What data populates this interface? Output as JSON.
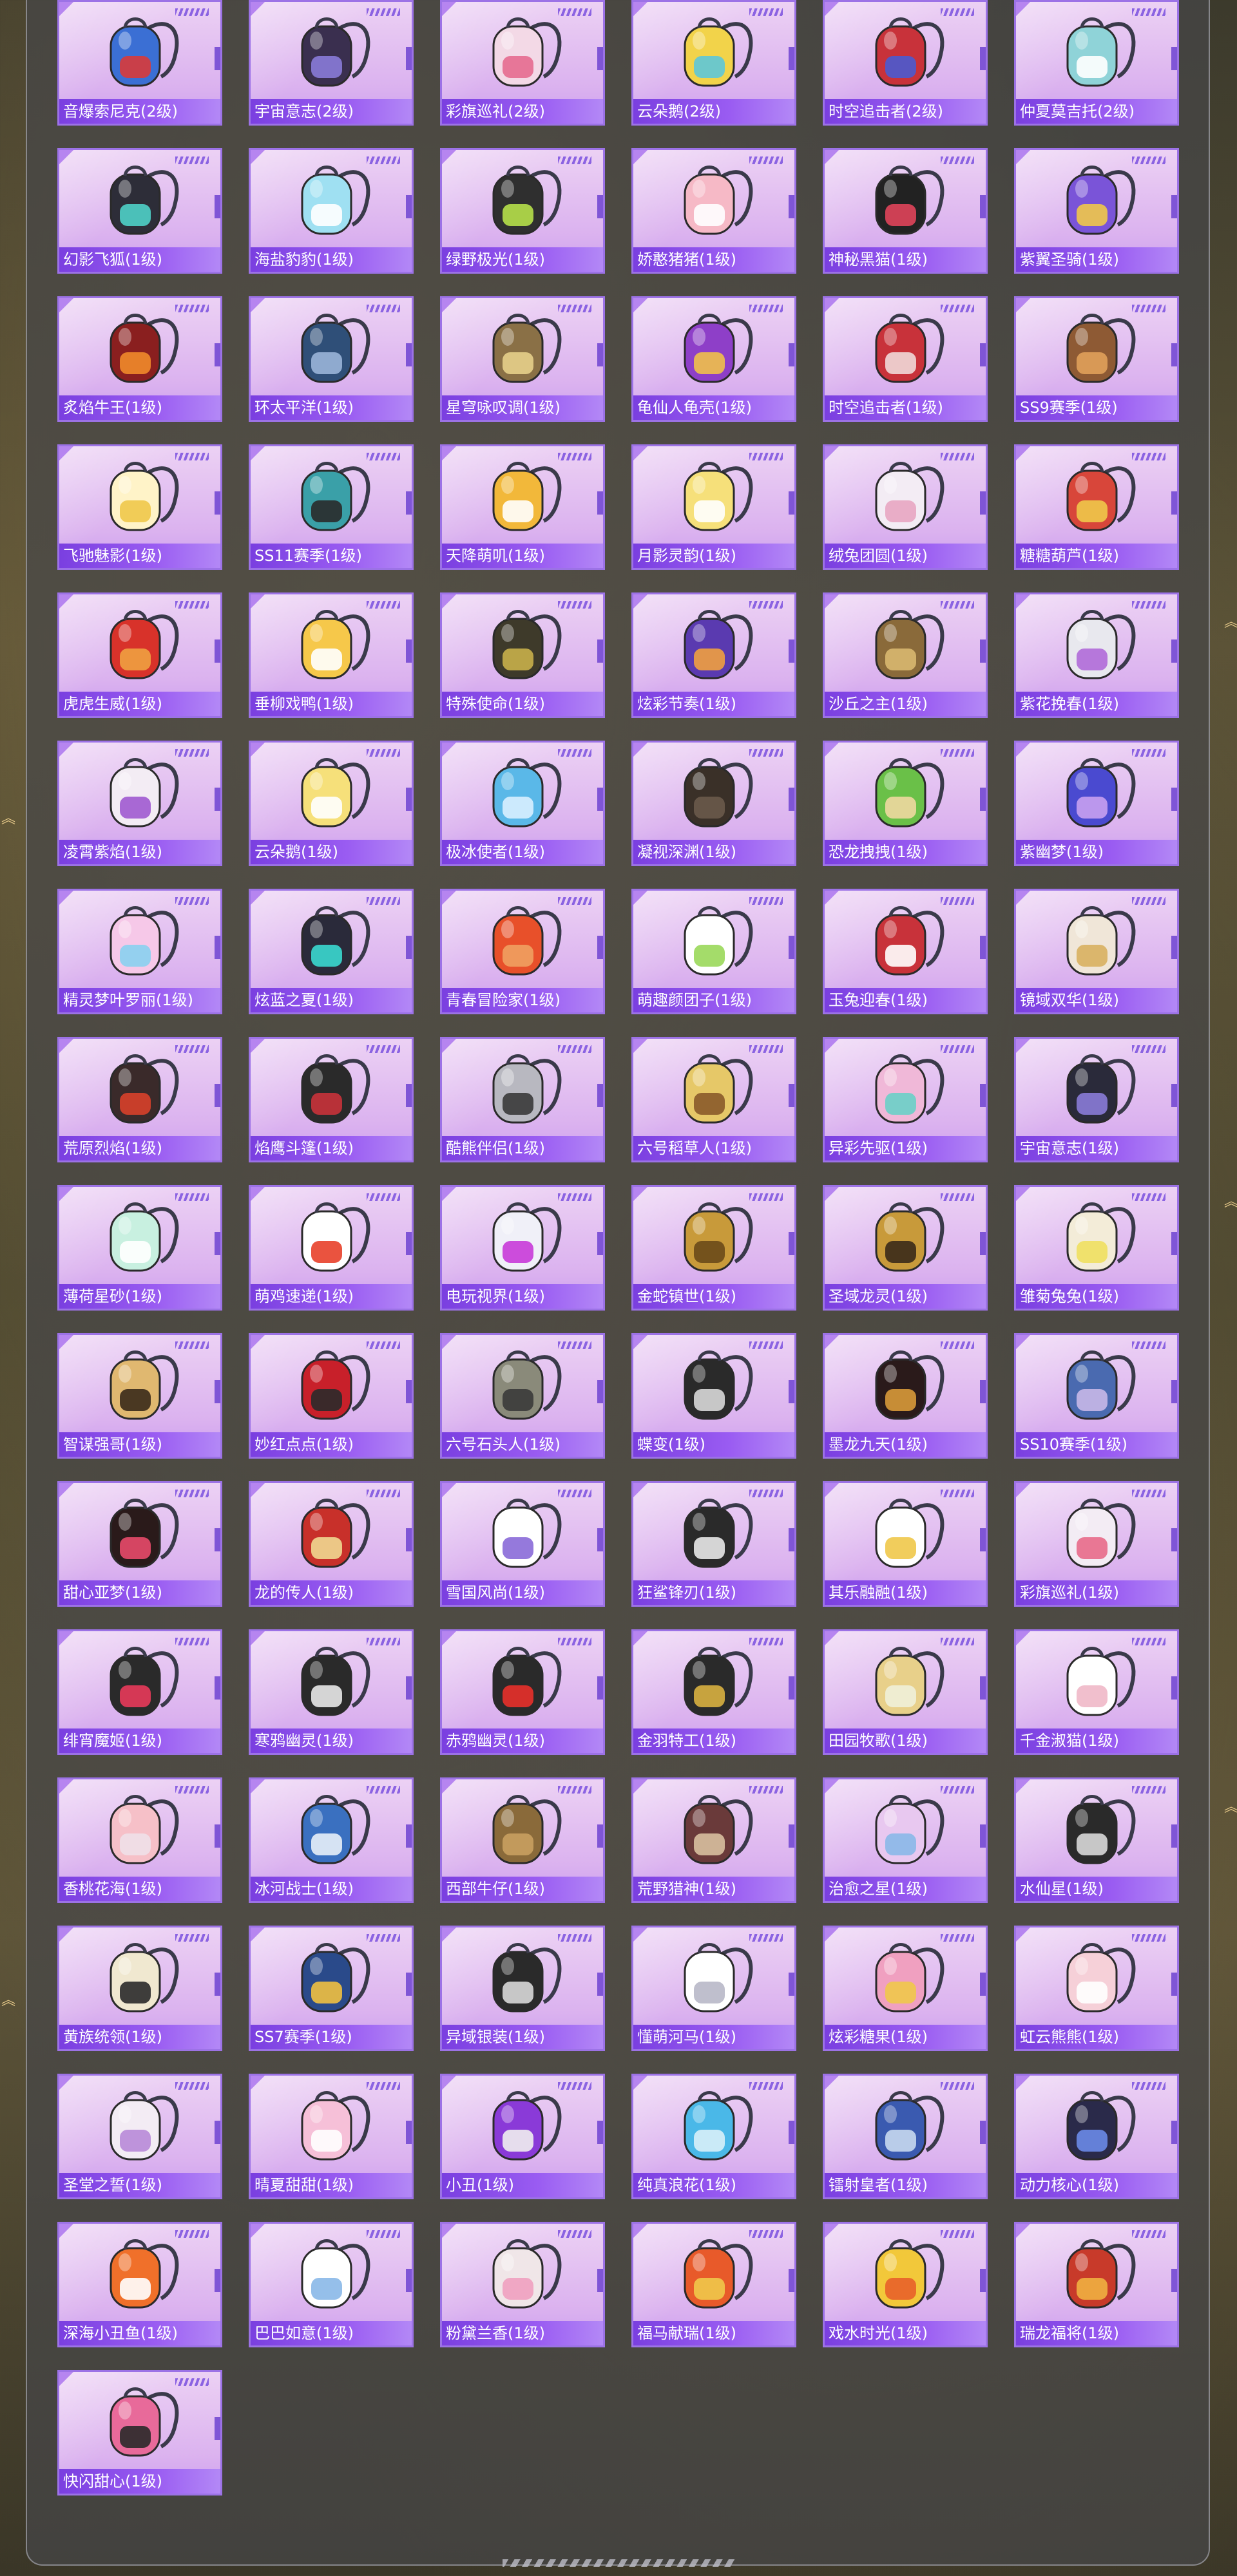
{
  "items": [
    {
      "name": "音爆索尼克(2级)",
      "color": "#3b6fd4",
      "accent": "#d93a3a"
    },
    {
      "name": "宇宙意志(2级)",
      "color": "#3a2f4f",
      "accent": "#8a7bd8"
    },
    {
      "name": "彩旗巡礼(2级)",
      "color": "#f3d9e6",
      "accent": "#e56a8f"
    },
    {
      "name": "云朵鹅(2级)",
      "color": "#f2d34a",
      "accent": "#5ec7d8"
    },
    {
      "name": "时空追击者(2级)",
      "color": "#c8323a",
      "accent": "#4a5ad0"
    },
    {
      "name": "仲夏莫吉托(2级)",
      "color": "#8fd3d8",
      "accent": "#ffffff"
    },
    {
      "name": "幻影飞狐(1级)",
      "color": "#2d2d38",
      "accent": "#4fd0c8"
    },
    {
      "name": "海盐豹豹(1级)",
      "color": "#9fe0f2",
      "accent": "#ffffff"
    },
    {
      "name": "绿野极光(1级)",
      "color": "#2f2f2f",
      "accent": "#b6e04a"
    },
    {
      "name": "娇憨猪猪(1级)",
      "color": "#f6b9c6",
      "accent": "#ffffff"
    },
    {
      "name": "神秘黑猫(1级)",
      "color": "#222222",
      "accent": "#e0445a"
    },
    {
      "name": "紫翼圣骑(1级)",
      "color": "#7a54d8",
      "accent": "#f0c84a"
    },
    {
      "name": "炙焰牛王(1级)",
      "color": "#8a1f1f",
      "accent": "#f08a2a"
    },
    {
      "name": "环太平洋(1级)",
      "color": "#2f4f78",
      "accent": "#9ab4d8"
    },
    {
      "name": "星穹咏叹调(1级)",
      "color": "#8a7046",
      "accent": "#e6cf8a"
    },
    {
      "name": "龟仙人龟壳(1级)",
      "color": "#8e3fc8",
      "accent": "#f0c04a"
    },
    {
      "name": "时空追击者(1级)",
      "color": "#c8323a",
      "accent": "#f0d8d8"
    },
    {
      "name": "SS9赛季(1级)",
      "color": "#8e5a34",
      "accent": "#e0a05a"
    },
    {
      "name": "飞驰魅影(1级)",
      "color": "#fff3c8",
      "accent": "#f0c84a"
    },
    {
      "name": "SS11赛季(1级)",
      "color": "#3aa0a8",
      "accent": "#2a2a2a"
    },
    {
      "name": "天降萌叽(1级)",
      "color": "#f2b83a",
      "accent": "#ffffff"
    },
    {
      "name": "月影灵韵(1级)",
      "color": "#f6e07a",
      "accent": "#ffffff"
    },
    {
      "name": "绒兔团圆(1级)",
      "color": "#f3ecf4",
      "accent": "#e8a6c2"
    },
    {
      "name": "糖糖葫芦(1级)",
      "color": "#d8463a",
      "accent": "#f0c84a"
    },
    {
      "name": "虎虎生威(1级)",
      "color": "#d8322a",
      "accent": "#f0a040"
    },
    {
      "name": "垂柳戏鸭(1级)",
      "color": "#f6c84a",
      "accent": "#ffffff"
    },
    {
      "name": "特殊使命(1级)",
      "color": "#3e3a2a",
      "accent": "#c8b04a"
    },
    {
      "name": "炫彩节奏(1级)",
      "color": "#5a3ab0",
      "accent": "#f0a040"
    },
    {
      "name": "沙丘之主(1级)",
      "color": "#8a6a3a",
      "accent": "#d8b870"
    },
    {
      "name": "紫花挽春(1级)",
      "color": "#e8e8ee",
      "accent": "#b06ad8"
    },
    {
      "name": "凌霄紫焰(1级)",
      "color": "#f3ecf4",
      "accent": "#a05ad0"
    },
    {
      "name": "云朵鹅(1级)",
      "color": "#f6e07a",
      "accent": "#ffffff"
    },
    {
      "name": "极冰使者(1级)",
      "color": "#5ab8e8",
      "accent": "#d8f0ff"
    },
    {
      "name": "凝视深渊(1级)",
      "color": "#3a3028",
      "accent": "#6a5a4a"
    },
    {
      "name": "恐龙拽拽(1级)",
      "color": "#6ac048",
      "accent": "#f0d8a0"
    },
    {
      "name": "紫幽梦(1级)",
      "color": "#4a4ad0",
      "accent": "#c8a0f0"
    },
    {
      "name": "精灵梦叶罗丽(1级)",
      "color": "#f6c8e8",
      "accent": "#8ad0f0"
    },
    {
      "name": "炫蓝之夏(1级)",
      "color": "#2a2a3a",
      "accent": "#3ad8d0"
    },
    {
      "name": "青春冒险家(1级)",
      "color": "#e8502a",
      "accent": "#f0a060"
    },
    {
      "name": "萌趣颜团子(1级)",
      "color": "#ffffff",
      "accent": "#9ad85a"
    },
    {
      "name": "玉兔迎春(1级)",
      "color": "#c8323a",
      "accent": "#ffffff"
    },
    {
      "name": "镜域双华(1级)",
      "color": "#f0e6d8",
      "accent": "#d8b060"
    },
    {
      "name": "荒原烈焰(1级)",
      "color": "#3a2a2a",
      "accent": "#d8402a"
    },
    {
      "name": "焰鹰斗篷(1级)",
      "color": "#2a2a2a",
      "accent": "#c8323a"
    },
    {
      "name": "酷熊伴侣(1级)",
      "color": "#b8b8c0",
      "accent": "#3a3a3a"
    },
    {
      "name": "六号稻草人(1级)",
      "color": "#e6c868",
      "accent": "#8a5a2a"
    },
    {
      "name": "异彩先驱(1级)",
      "color": "#f0b8d8",
      "accent": "#6ad0c8"
    },
    {
      "name": "宇宙意志(1级)",
      "color": "#2a2a3a",
      "accent": "#8a7bd8"
    },
    {
      "name": "薄荷星砂(1级)",
      "color": "#c8f0e0",
      "accent": "#ffffff"
    },
    {
      "name": "萌鸡速递(1级)",
      "color": "#ffffff",
      "accent": "#e8402a"
    },
    {
      "name": "电玩视界(1级)",
      "color": "#f0f0f8",
      "accent": "#c83ad8"
    },
    {
      "name": "金蛇镇世(1级)",
      "color": "#c89a3a",
      "accent": "#6a4a1a"
    },
    {
      "name": "圣域龙灵(1级)",
      "color": "#c89a3a",
      "accent": "#3a2a1a"
    },
    {
      "name": "雏菊兔兔(1级)",
      "color": "#f3ecd8",
      "accent": "#f0e060"
    },
    {
      "name": "智谋强哥(1级)",
      "color": "#e0b870",
      "accent": "#3a2a1a"
    },
    {
      "name": "妙红点点(1级)",
      "color": "#c8202a",
      "accent": "#2a2a2a"
    },
    {
      "name": "六号石头人(1级)",
      "color": "#8a8a7a",
      "accent": "#3a3a3a"
    },
    {
      "name": "蝶变(1级)",
      "color": "#2a2a2a",
      "accent": "#d8d8d8"
    },
    {
      "name": "墨龙九天(1级)",
      "color": "#2a1a1a",
      "accent": "#d89a3a"
    },
    {
      "name": "SS10赛季(1级)",
      "color": "#4a6ab0",
      "accent": "#c8b8e8"
    },
    {
      "name": "甜心亚梦(1级)",
      "color": "#2a1a1a",
      "accent": "#e84a6a"
    },
    {
      "name": "龙的传人(1级)",
      "color": "#c8302a",
      "accent": "#f0d890"
    },
    {
      "name": "雪国风尚(1级)",
      "color": "#ffffff",
      "accent": "#8a6ad8"
    },
    {
      "name": "狂鲨锋刃(1级)",
      "color": "#2a2a2a",
      "accent": "#e8e8e8"
    },
    {
      "name": "其乐融融(1级)",
      "color": "#ffffff",
      "accent": "#f0c84a"
    },
    {
      "name": "彩旗巡礼(1级)",
      "color": "#f3ecf4",
      "accent": "#e86a8a"
    },
    {
      "name": "绯宵魔姬(1级)",
      "color": "#2a2a2a",
      "accent": "#e83a5a"
    },
    {
      "name": "寒鸦幽灵(1级)",
      "color": "#2a2a2a",
      "accent": "#e8e8e8"
    },
    {
      "name": "赤鸦幽灵(1级)",
      "color": "#2a2a2a",
      "accent": "#e8302a"
    },
    {
      "name": "金羽特工(1级)",
      "color": "#2a2a2a",
      "accent": "#d8b040"
    },
    {
      "name": "田园牧歌(1级)",
      "color": "#e8d08a",
      "accent": "#f0f0d8"
    },
    {
      "name": "千金淑猫(1级)",
      "color": "#ffffff",
      "accent": "#f0b8c8"
    },
    {
      "name": "香桃花海(1级)",
      "color": "#f6c0c8",
      "accent": "#f0e0e8"
    },
    {
      "name": "冰河战士(1级)",
      "color": "#3a70c0",
      "accent": "#e8f0f8"
    },
    {
      "name": "西部牛仔(1级)",
      "color": "#8a6a3a",
      "accent": "#c8a060"
    },
    {
      "name": "荒野猎神(1级)",
      "color": "#6a3a3a",
      "accent": "#d8c0a0"
    },
    {
      "name": "治愈之星(1级)",
      "color": "#e8c8f0",
      "accent": "#8ab8e8"
    },
    {
      "name": "水仙星(1级)",
      "color": "#2a2a2a",
      "accent": "#d8d8d8"
    },
    {
      "name": "黄族统领(1级)",
      "color": "#f0e8d0",
      "accent": "#2a2a2a"
    },
    {
      "name": "SS7赛季(1级)",
      "color": "#2a4a8a",
      "accent": "#f0c040"
    },
    {
      "name": "异域银装(1级)",
      "color": "#2a2a2a",
      "accent": "#d8d8d8"
    },
    {
      "name": "懂萌河马(1级)",
      "color": "#ffffff",
      "accent": "#b8b8c8"
    },
    {
      "name": "炫彩糖果(1级)",
      "color": "#f0a0c0",
      "accent": "#f0c84a"
    },
    {
      "name": "虹云熊熊(1级)",
      "color": "#f6d0d8",
      "accent": "#ffffff"
    },
    {
      "name": "圣堂之誓(1级)",
      "color": "#f3ecf4",
      "accent": "#b88ad8"
    },
    {
      "name": "晴夏甜甜(1级)",
      "color": "#f6c0d8",
      "accent": "#ffffff"
    },
    {
      "name": "小丑(1级)",
      "color": "#8a3ad8",
      "accent": "#f0f0f0"
    },
    {
      "name": "纯真浪花(1级)",
      "color": "#4ab8e8",
      "accent": "#d8f0f8"
    },
    {
      "name": "镭射皇者(1级)",
      "color": "#3a5ab0",
      "accent": "#c8d8f0"
    },
    {
      "name": "动力核心(1级)",
      "color": "#2a2a4a",
      "accent": "#6a8ae8"
    },
    {
      "name": "深海小丑鱼(1级)",
      "color": "#f0702a",
      "accent": "#ffffff"
    },
    {
      "name": "巴巴如意(1级)",
      "color": "#ffffff",
      "accent": "#8ab8e8"
    },
    {
      "name": "粉黛兰香(1级)",
      "color": "#f0e6e8",
      "accent": "#f0a0c0"
    },
    {
      "name": "福马献瑞(1级)",
      "color": "#e85a2a",
      "accent": "#f0c84a"
    },
    {
      "name": "戏水时光(1级)",
      "color": "#f2c83a",
      "accent": "#e8602a"
    },
    {
      "name": "瑞龙福将(1级)",
      "color": "#c83a2a",
      "accent": "#f0b040"
    },
    {
      "name": "快闪甜心(1级)",
      "color": "#e86a9a",
      "accent": "#2a2a2a"
    }
  ]
}
